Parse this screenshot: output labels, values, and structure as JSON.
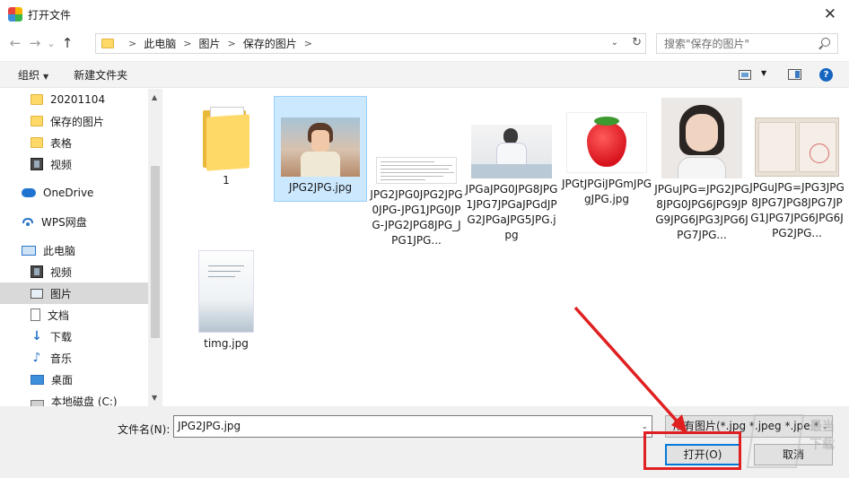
{
  "window": {
    "title": "打开文件",
    "close_glyph": "✕"
  },
  "nav": {
    "back": "←",
    "forward": "→",
    "recent": "⌄",
    "up": "↑"
  },
  "breadcrumb": {
    "items": [
      "此电脑",
      "图片",
      "保存的图片"
    ],
    "sep": ">",
    "dropdown": "⌄",
    "refresh": "↻"
  },
  "search": {
    "placeholder": "搜索\"保存的图片\""
  },
  "toolbar": {
    "organize_label": "组织",
    "caret": "▼",
    "new_folder_label": "新建文件夹",
    "help_glyph": "?"
  },
  "sidebar": {
    "items": [
      {
        "label": "20201104",
        "icon": "folder-icon"
      },
      {
        "label": "保存的图片",
        "icon": "folder-icon"
      },
      {
        "label": "表格",
        "icon": "folder-icon"
      },
      {
        "label": "视频",
        "icon": "video-icon"
      },
      {
        "label": "OneDrive",
        "icon": "cloud-icon"
      },
      {
        "label": "WPS网盘",
        "icon": "wps-cloud-icon"
      },
      {
        "label": "此电脑",
        "icon": "computer-icon"
      },
      {
        "label": "视频",
        "icon": "video-icon"
      },
      {
        "label": "图片",
        "icon": "pictures-icon",
        "selected": true
      },
      {
        "label": "文档",
        "icon": "documents-icon"
      },
      {
        "label": "下载",
        "icon": "download-icon"
      },
      {
        "label": "音乐",
        "icon": "music-icon"
      },
      {
        "label": "桌面",
        "icon": "desktop-icon"
      },
      {
        "label": "本地磁盘 (C:)",
        "icon": "disk-icon"
      }
    ],
    "scroll_up": "▲",
    "scroll_down": "▼"
  },
  "files": [
    {
      "name": "1",
      "type": "folder"
    },
    {
      "name": "JPG2JPG.jpg",
      "type": "image",
      "selected": true
    },
    {
      "name": "JPG2JPG0JPG2JPG0JPG-JPG1JPG0JPG-JPG2JPG8JPG_JPG1JPG...",
      "type": "image"
    },
    {
      "name": "JPGaJPG0JPG8JPG1JPG7JPGaJPGdJPG2JPGaJPG5JPG.jpg",
      "type": "image"
    },
    {
      "name": "JPGtJPGiJPGmJPGgJPG.jpg",
      "type": "image"
    },
    {
      "name": "JPGuJPG=JPG2JPG8JPG0JPG6JPG9JPG9JPG6JPG3JPG6JPG7JPG...",
      "type": "image"
    },
    {
      "name": "JPGuJPG=JPG3JPG8JPG7JPG8JPG7JPG1JPG7JPG6JPG6JPG2JPG...",
      "type": "image"
    },
    {
      "name": "timg.jpg",
      "type": "image"
    }
  ],
  "bottom": {
    "filename_label": "文件名(N):",
    "filename_value": "JPG2JPG.jpg",
    "filetype_value": "所有图片(*.jpg *.jpeg *.jpe *.b",
    "open_label": "打开(O)",
    "cancel_label": "取消"
  },
  "watermark": {
    "text": "最当下载"
  },
  "colors": {
    "accent": "#0078d7",
    "annotation": "#e02020",
    "selection": "#cce8ff",
    "folder": "#ffd968"
  }
}
